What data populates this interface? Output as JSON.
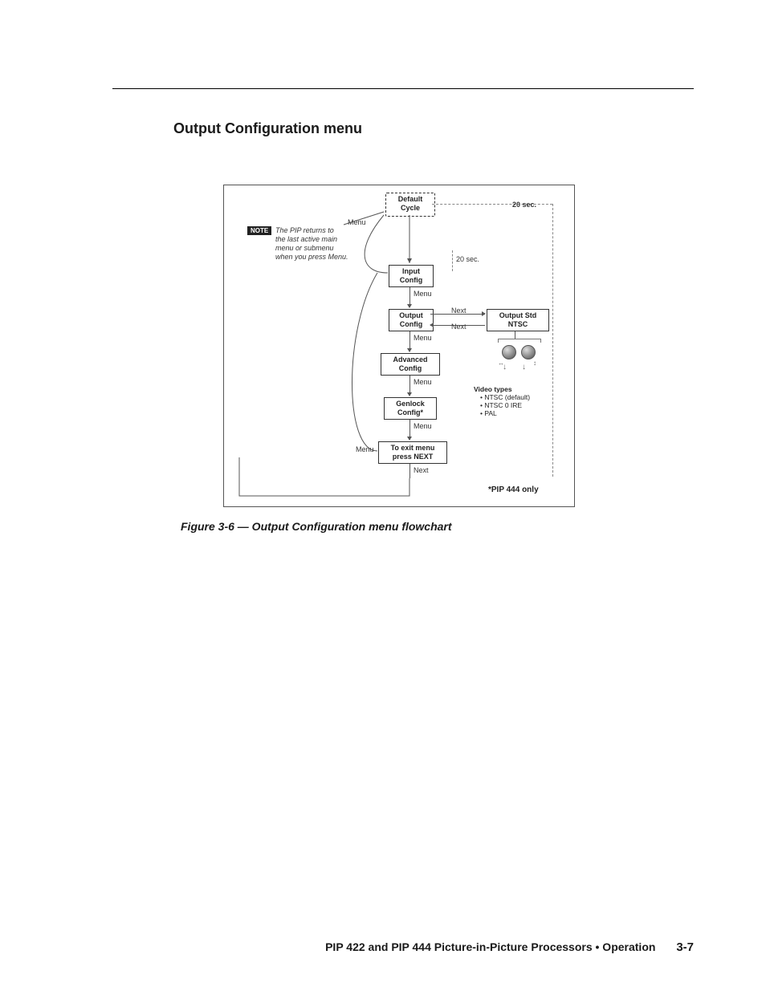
{
  "page": {
    "section_title": "Output Configuration menu",
    "caption": "Figure 3-6 — Output Configuration menu flowchart",
    "footer_text": "PIP 422 and PIP 444 Picture-in-Picture Processors • Operation",
    "page_number": "3-7"
  },
  "chart_data": {
    "type": "diagram",
    "note_badge": "NOTE",
    "note_lines": [
      "The PIP returns to",
      "the last active main",
      "menu or submenu",
      "when you press Menu."
    ],
    "timeout_label": "20 sec.",
    "nodes": {
      "default": {
        "line1": "Default",
        "line2": "Cycle"
      },
      "input": {
        "line1": "Input",
        "line2": "Config"
      },
      "output": {
        "line1": "Output",
        "line2": "Config"
      },
      "advanced": {
        "line1": "Advanced",
        "line2": "Config"
      },
      "genlock": {
        "line1": "Genlock",
        "line2": "Config*"
      },
      "exit": {
        "line1": "To exit menu",
        "line2": "press NEXT"
      },
      "outputstd": {
        "line1": "Output Std",
        "line2": "NTSC"
      }
    },
    "edge_labels": {
      "menu": "Menu",
      "next": "Next"
    },
    "video_types": {
      "header": "Video types",
      "items": [
        "NTSC (default)",
        "NTSC 0 IRE",
        "PAL"
      ]
    },
    "footnote": "*PIP 444 only"
  }
}
